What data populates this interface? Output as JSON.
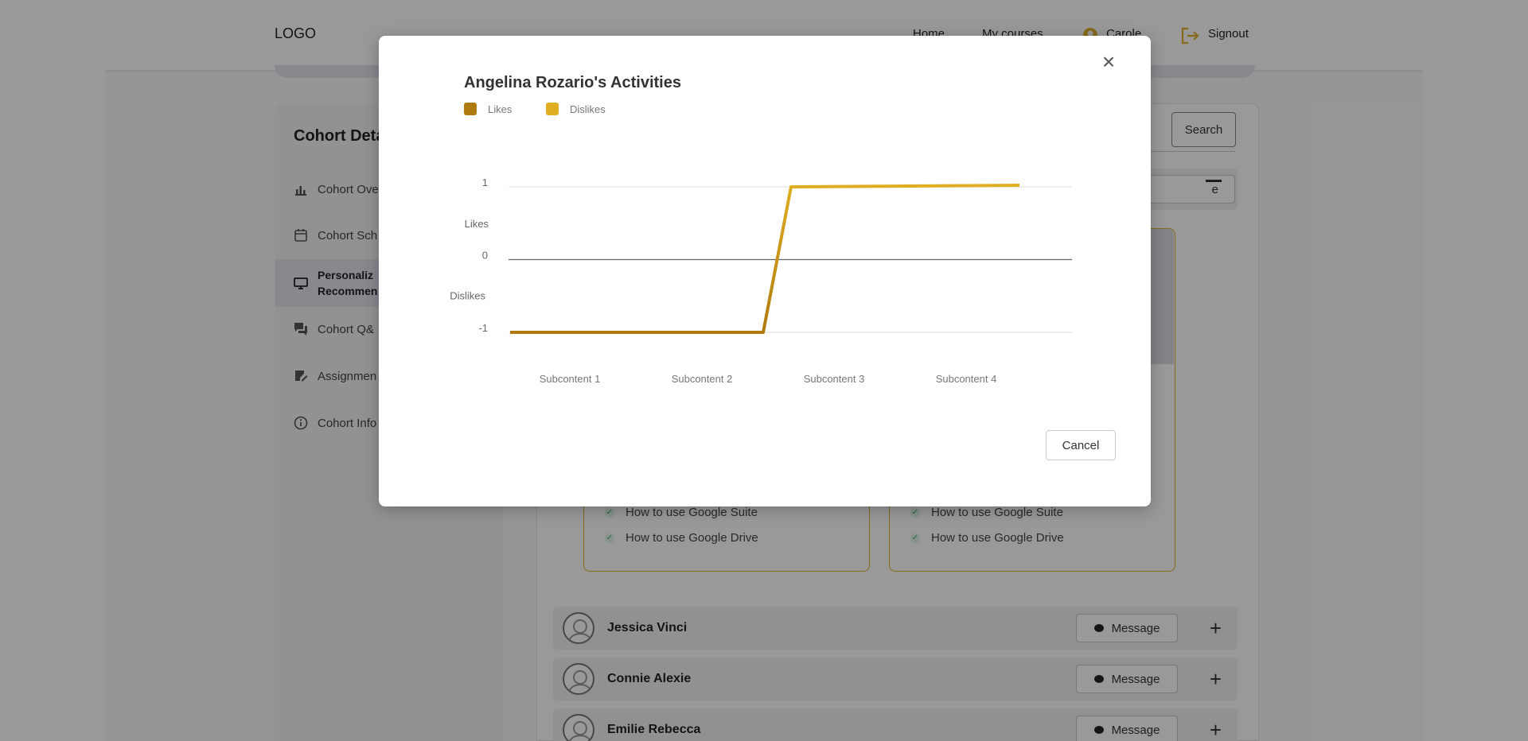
{
  "header": {
    "logo": "LOGO",
    "nav": {
      "home": "Home",
      "courses": "My courses",
      "user": "Carole",
      "signout": "Signout"
    }
  },
  "sidebar": {
    "title": "Cohort Deta",
    "items": [
      {
        "label": "Cohort Ove",
        "icon": "bar-chart-icon"
      },
      {
        "label": "Cohort Sch",
        "icon": "calendar-icon"
      },
      {
        "label_line1": "Personaliz",
        "label_line2": "Recommen",
        "icon": "monitor-icon"
      },
      {
        "label": "Cohort Q&",
        "icon": "chat-icon"
      },
      {
        "label": "Assignmen",
        "icon": "edit-note-icon"
      },
      {
        "label": "Cohort Info",
        "icon": "info-icon"
      }
    ]
  },
  "main": {
    "search_label": "Search",
    "partial_button": "e",
    "cards": [
      {
        "items": [
          "How to use Google Suite",
          "How to use Google Drive"
        ]
      },
      {
        "items": [
          "How to use Google Suite",
          "How to use Google Drive"
        ]
      }
    ],
    "learners": [
      {
        "name": "Jessica Vinci"
      },
      {
        "name": "Connie Alexie"
      },
      {
        "name": "Emilie Rebecca"
      }
    ],
    "message_label": "Message"
  },
  "modal": {
    "title": "Angelina Rozario's Activities",
    "cancel_label": "Cancel",
    "close_icon": "close-icon"
  },
  "colors": {
    "likes": "#b07b0e",
    "dislikes": "#dfae22",
    "accent": "#e0b12a"
  },
  "chart_data": {
    "type": "line",
    "title": "Angelina Rozario's Activities",
    "categories": [
      "Subcontent 1",
      "Subcontent 2",
      "Subcontent 3",
      "Subcontent 4"
    ],
    "series": [
      {
        "name": "Likes",
        "values": [
          -1,
          -1,
          1,
          1
        ]
      },
      {
        "name": "Dislikes",
        "values": [
          -1,
          -1,
          1,
          1
        ]
      }
    ],
    "y_ticks": [
      {
        "value": 1,
        "label": "1"
      },
      {
        "value": 0,
        "label": "0"
      },
      {
        "value": -1,
        "label": "-1"
      }
    ],
    "y_annotations": [
      {
        "value": 0.5,
        "label": "Likes"
      },
      {
        "value": -0.5,
        "label": "Dislikes"
      }
    ],
    "ylim": [
      -1,
      1
    ],
    "legend": "top-left",
    "grid": true
  }
}
